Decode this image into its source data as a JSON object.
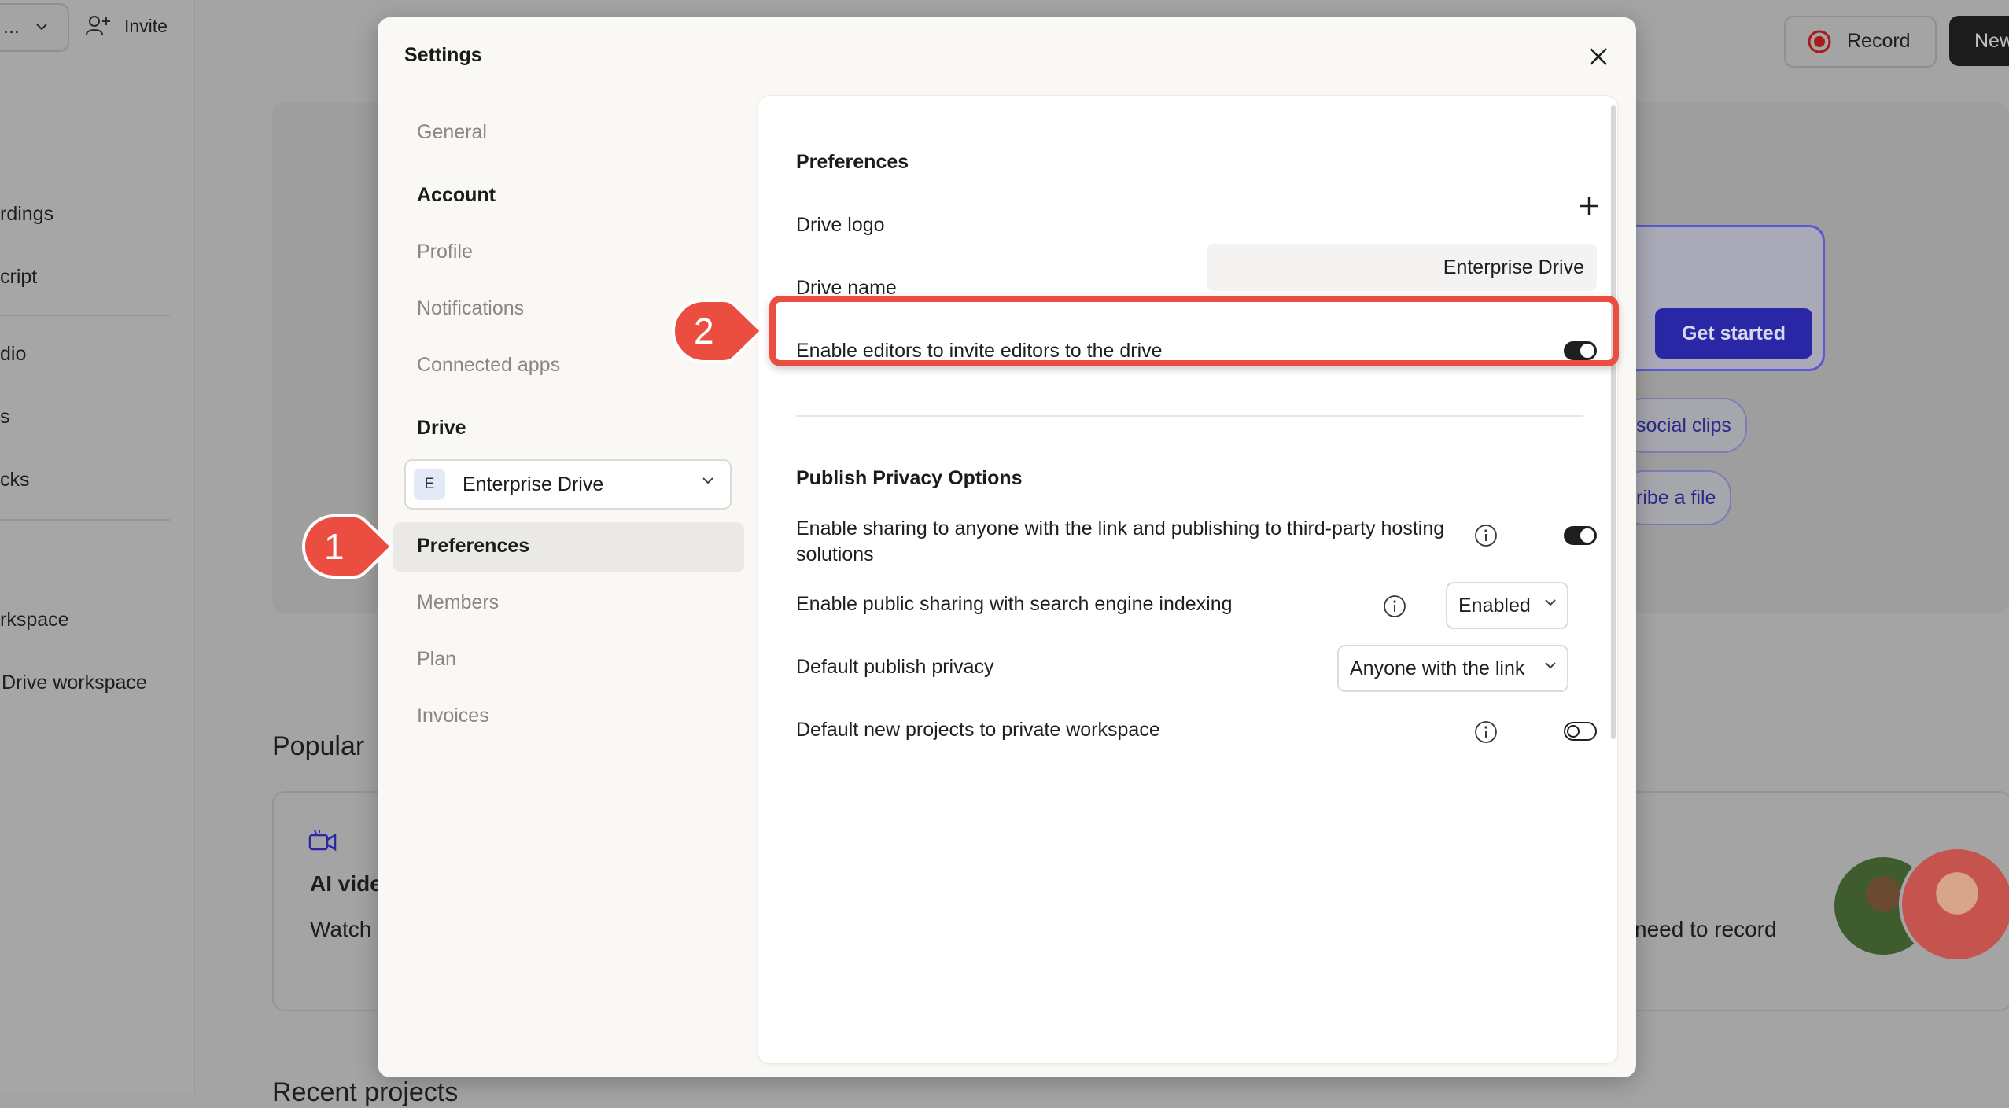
{
  "background": {
    "topbar": {
      "workspace_fragment": "...",
      "invite_label": "Invite",
      "record_label": "Record",
      "new_label": "New"
    },
    "sidebar_fragments": [
      "rdings",
      "cript",
      "dio",
      "s",
      "cks",
      "rkspace",
      "Drive workspace"
    ],
    "get_started_label": "Get started",
    "chips": [
      "social clips",
      "ribe a file"
    ],
    "popular_heading": "Popular",
    "card": {
      "title_fragment": "AI vide",
      "desc_fragment": "Watch",
      "right_text_fragment": "need to record"
    },
    "recent_heading_fragment": "Recent projects"
  },
  "settings": {
    "title": "Settings",
    "nav": {
      "general": "General",
      "account_heading": "Account",
      "profile": "Profile",
      "notifications": "Notifications",
      "connected_apps": "Connected apps",
      "drive_heading": "Drive",
      "drive_selector": {
        "badge": "E",
        "label": "Enterprise Drive"
      },
      "preferences": "Preferences",
      "members": "Members",
      "plan": "Plan",
      "invoices": "Invoices"
    },
    "panel": {
      "preferences_heading": "Preferences",
      "drive_logo_label": "Drive logo",
      "drive_name_label": "Drive name",
      "drive_name_value": "Enterprise Drive",
      "invite_editors_label": "Enable editors to invite editors to the drive",
      "invite_editors_on": true,
      "publish_heading": "Publish Privacy Options",
      "sharing_link_label": "Enable sharing to anyone with the link and publishing to third-party hosting solutions",
      "sharing_link_on": true,
      "search_indexing_label": "Enable public sharing with search engine indexing",
      "search_indexing_value": "Enabled",
      "default_privacy_label": "Default publish privacy",
      "default_privacy_value": "Anyone with the link",
      "private_workspace_label": "Default new projects to private workspace",
      "private_workspace_on": false
    }
  },
  "annotations": {
    "step1": "1",
    "step2": "2"
  },
  "colors": {
    "accent_red": "#ec4d41",
    "primary_blue": "#2a27a6",
    "toggle_dark": "#1f1f1f"
  }
}
